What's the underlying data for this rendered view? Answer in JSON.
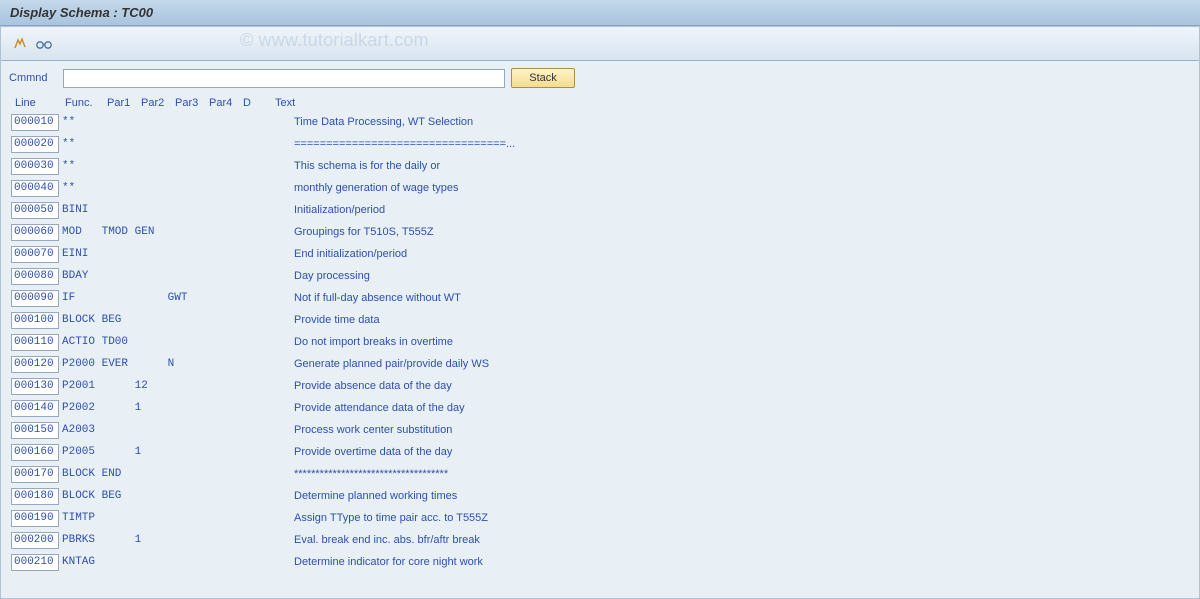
{
  "title": "Display Schema : TC00",
  "watermark": "© www.tutorialkart.com",
  "toolbar": {
    "cmd_label": "Cmmnd",
    "cmd_value": "",
    "stack_label": "Stack"
  },
  "headers": {
    "line": "Line",
    "func": "Func.",
    "par1": "Par1",
    "par2": "Par2",
    "par3": "Par3",
    "par4": "Par4",
    "d": "D",
    "text": "Text"
  },
  "rows": [
    {
      "line": "000010",
      "func": "**",
      "par1": "",
      "par2": "",
      "par3": "",
      "par4": "",
      "d": "",
      "text": "Time Data Processing, WT Selection"
    },
    {
      "line": "000020",
      "func": "**",
      "par1": "",
      "par2": "",
      "par3": "",
      "par4": "",
      "d": "",
      "text": "=================================..."
    },
    {
      "line": "000030",
      "func": "**",
      "par1": "",
      "par2": "",
      "par3": "",
      "par4": "",
      "d": "",
      "text": "This schema is for the daily or"
    },
    {
      "line": "000040",
      "func": "**",
      "par1": "",
      "par2": "",
      "par3": "",
      "par4": "",
      "d": "",
      "text": "monthly generation of wage types"
    },
    {
      "line": "000050",
      "func": "BINI",
      "par1": "",
      "par2": "",
      "par3": "",
      "par4": "",
      "d": "",
      "text": "Initialization/period"
    },
    {
      "line": "000060",
      "func": "MOD",
      "par1": "TMOD",
      "par2": "GEN",
      "par3": "",
      "par4": "",
      "d": "",
      "text": "Groupings for T510S, T555Z"
    },
    {
      "line": "000070",
      "func": "EINI",
      "par1": "",
      "par2": "",
      "par3": "",
      "par4": "",
      "d": "",
      "text": "End initialization/period"
    },
    {
      "line": "000080",
      "func": "BDAY",
      "par1": "",
      "par2": "",
      "par3": "",
      "par4": "",
      "d": "",
      "text": "Day processing"
    },
    {
      "line": "000090",
      "func": "IF",
      "par1": "",
      "par2": "",
      "par3": "GWT",
      "par4": "",
      "d": "",
      "text": "Not if full-day absence without WT"
    },
    {
      "line": "000100",
      "func": "BLOCK",
      "par1": "BEG",
      "par2": "",
      "par3": "",
      "par4": "",
      "d": "",
      "text": "Provide time data"
    },
    {
      "line": "000110",
      "func": "ACTIO",
      "par1": "TD00",
      "par2": "",
      "par3": "",
      "par4": "",
      "d": "",
      "text": "Do not import breaks in overtime"
    },
    {
      "line": "000120",
      "func": "P2000",
      "par1": "EVER",
      "par2": "",
      "par3": "N",
      "par4": "",
      "d": "",
      "text": "Generate planned pair/provide daily WS"
    },
    {
      "line": "000130",
      "func": "P2001",
      "par1": "",
      "par2": "12",
      "par3": "",
      "par4": "",
      "d": "",
      "text": "Provide absence data of the day"
    },
    {
      "line": "000140",
      "func": "P2002",
      "par1": "",
      "par2": "1",
      "par3": "",
      "par4": "",
      "d": "",
      "text": "Provide attendance data of the day"
    },
    {
      "line": "000150",
      "func": "A2003",
      "par1": "",
      "par2": "",
      "par3": "",
      "par4": "",
      "d": "",
      "text": "Process work center substitution"
    },
    {
      "line": "000160",
      "func": "P2005",
      "par1": "",
      "par2": "1",
      "par3": "",
      "par4": "",
      "d": "",
      "text": "Provide overtime data of the day"
    },
    {
      "line": "000170",
      "func": "BLOCK",
      "par1": "END",
      "par2": "",
      "par3": "",
      "par4": "",
      "d": "",
      "text": "************************************"
    },
    {
      "line": "000180",
      "func": "BLOCK",
      "par1": "BEG",
      "par2": "",
      "par3": "",
      "par4": "",
      "d": "",
      "text": "Determine planned working times"
    },
    {
      "line": "000190",
      "func": "TIMTP",
      "par1": "",
      "par2": "",
      "par3": "",
      "par4": "",
      "d": "",
      "text": "Assign TType to time pair acc. to T555Z"
    },
    {
      "line": "000200",
      "func": "PBRKS",
      "par1": "",
      "par2": "1",
      "par3": "",
      "par4": "",
      "d": "",
      "text": "Eval. break end inc. abs. bfr/aftr break"
    },
    {
      "line": "000210",
      "func": "KNTAG",
      "par1": "",
      "par2": "",
      "par3": "",
      "par4": "",
      "d": "",
      "text": "Determine indicator for core night work"
    }
  ]
}
